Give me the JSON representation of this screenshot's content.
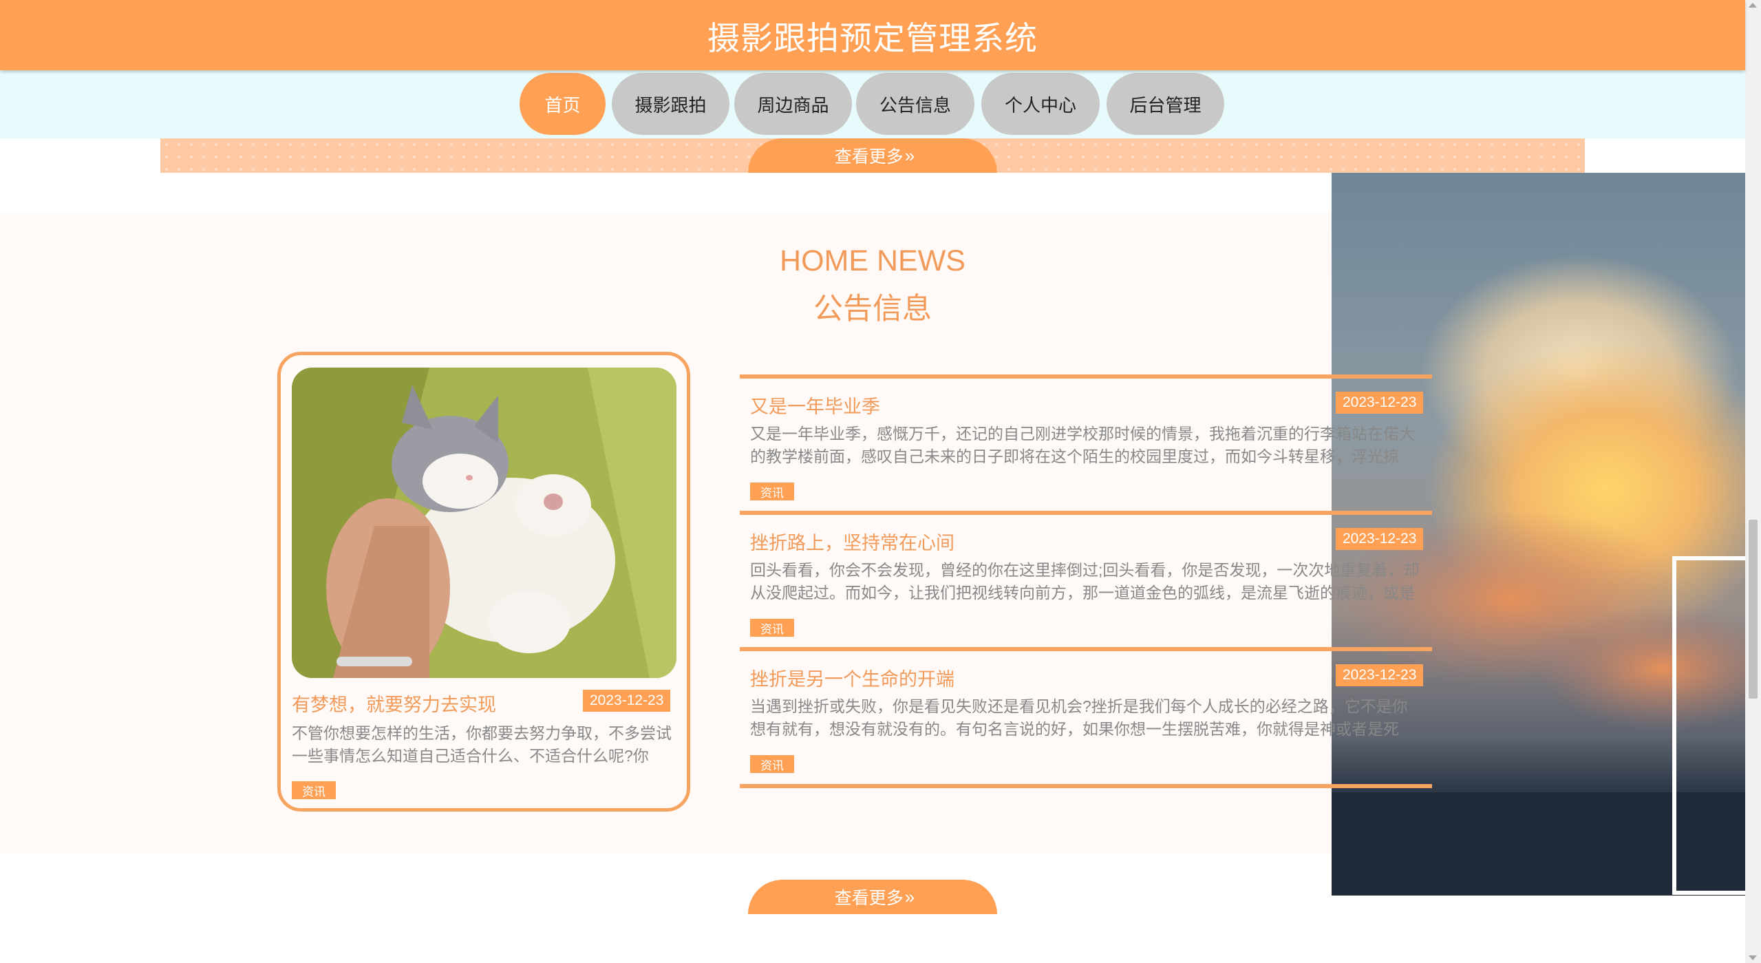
{
  "header": {
    "title": "摄影跟拍预定管理系统"
  },
  "nav": {
    "items": [
      {
        "label": "首页"
      },
      {
        "label": "摄影跟拍"
      },
      {
        "label": "周边商品"
      },
      {
        "label": "公告信息"
      },
      {
        "label": "个人中心"
      },
      {
        "label": "后台管理"
      }
    ],
    "active": "首页"
  },
  "more_label": "查看更多",
  "chevron_glyph": "»",
  "news": {
    "title_en": "HOME NEWS",
    "title_cn": "公告信息",
    "featured": {
      "title": "有梦想，就要努力去实现",
      "date": "2023-12-23",
      "desc": "不管你想要怎样的生活，你都要去努力争取，不多尝试一些事情怎么知道自己适合什么、不适合什么呢?你说…",
      "tag": "资讯"
    },
    "items": [
      {
        "title": "又是一年毕业季",
        "date": "2023-12-23",
        "desc": "又是一年毕业季，感慨万千，还记的自己刚进学校那时候的情景，我拖着沉重的行李箱站在偌大的教学楼前面，感叹自己未来的日子即将在这个陌生的校园里度过，而如今斗转星移，浮光掠影，…",
        "tag": "资讯"
      },
      {
        "title": "挫折路上，坚持常在心间",
        "date": "2023-12-23",
        "desc": "回头看看，你会不会发现，曾经的你在这里摔倒过;回头看看，你是否发现，一次次地重复着，却从没爬起过。而如今，让我们把视线转向前方，那一道道金色的弧线，是流星飞逝的痕迹，或是成…",
        "tag": "资讯"
      },
      {
        "title": "挫折是另一个生命的开端",
        "date": "2023-12-23",
        "desc": "当遇到挫折或失败，你是看见失败还是看见机会?挫折是我们每个人成长的必经之路，它不是你想有就有，想没有就没有的。有句名言说的好，如果你想一生摆脱苦难，你就得是神或者是死尸。…",
        "tag": "资讯"
      }
    ]
  },
  "colors": {
    "accent": "#ffa055",
    "accent_text": "#f29a5a",
    "nav_bg": "#e8fbfc",
    "nav_inactive": "#c8c8c8"
  }
}
